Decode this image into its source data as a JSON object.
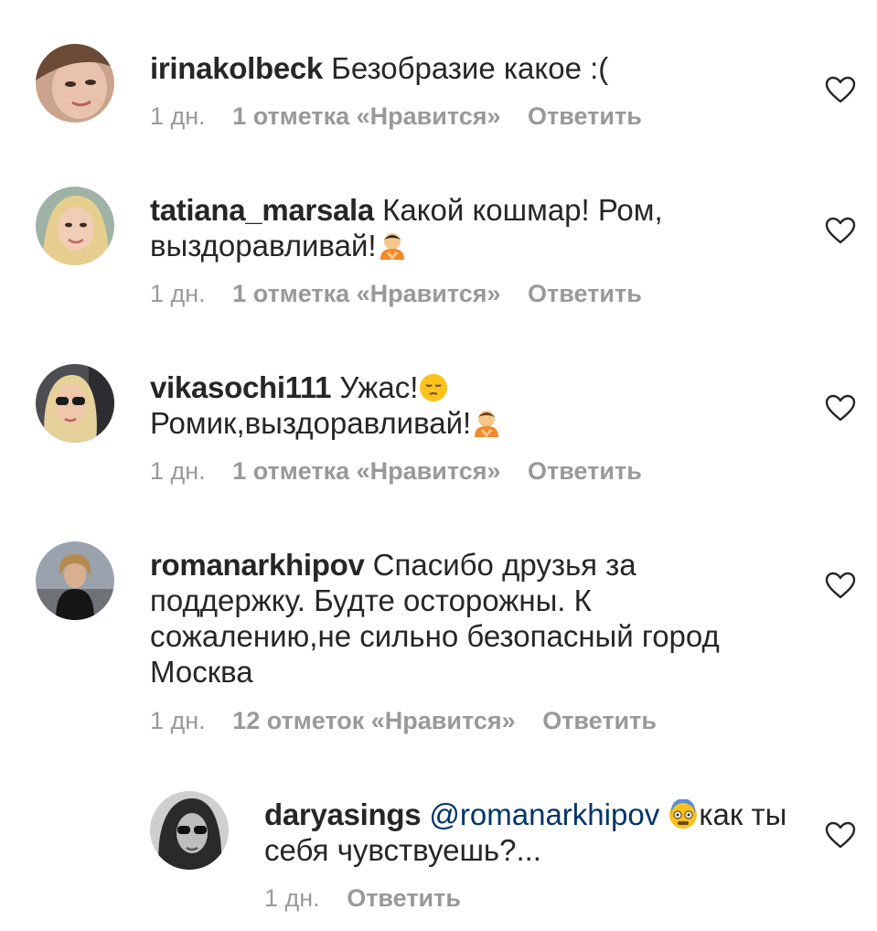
{
  "comments": [
    {
      "username": "irinakolbeck",
      "text": "Безобразие какое :(",
      "time": "1 дн.",
      "likes": "1 отметка «Нравится»",
      "reply": "Ответить",
      "avatar_icon": "avatar-woman-closeup"
    },
    {
      "username": "tatiana_marsala",
      "text_a": "Какой кошмар! Ром,",
      "text_b": "выздоравливай!",
      "emoji_icon": "person-bowing-emoji",
      "time": "1 дн.",
      "likes": "1 отметка «Нравится»",
      "reply": "Ответить",
      "avatar_icon": "avatar-blonde-woman"
    },
    {
      "username": "vikasochi111",
      "text_a": "Ужас!",
      "text_b": "Ромик,выздоравливай!",
      "emoji_icon_a": "pensive-face-emoji",
      "emoji_icon_b": "person-bowing-emoji",
      "time": "1 дн.",
      "likes": "1 отметка «Нравится»",
      "reply": "Ответить",
      "avatar_icon": "avatar-woman-sunglasses-car"
    },
    {
      "username": "romanarkhipov",
      "text_a": "Спасибо друзья за",
      "text_b": "поддержку. Будте осторожны. К",
      "text_c": "сожалению,не сильно безопасный город",
      "text_d": "Москва",
      "time": "1 дн.",
      "likes": "12 отметок «Нравится»",
      "reply": "Ответить",
      "avatar_icon": "avatar-man-runway"
    },
    {
      "username": "daryasings",
      "mention": "@romanarkhipov",
      "text_a": "как ты",
      "text_b": "себя чувствуешь?...",
      "emoji_icon": "fearful-face-emoji",
      "time": "1 дн.",
      "reply": "Ответить",
      "avatar_icon": "avatar-woman-bw-sunglasses"
    }
  ],
  "icons": {
    "like": "heart-outline-icon"
  },
  "colors": {
    "text": "#262626",
    "meta": "#999999",
    "mention": "#003569",
    "heart": "#262626"
  }
}
